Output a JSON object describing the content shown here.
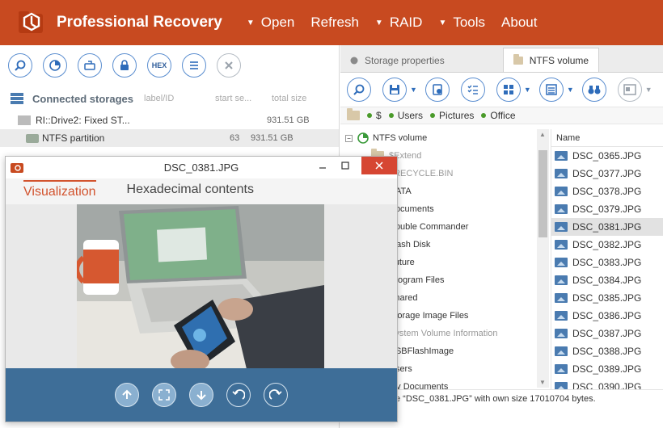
{
  "app": {
    "title": "Professional Recovery"
  },
  "menu": [
    {
      "label": "Open",
      "caret": true
    },
    {
      "label": "Refresh",
      "caret": false
    },
    {
      "label": "RAID",
      "caret": true
    },
    {
      "label": "Tools",
      "caret": true
    },
    {
      "label": "About",
      "caret": false
    }
  ],
  "left": {
    "hex_label": "HEX",
    "header": {
      "title": "Connected storages",
      "col_label": "label/ID",
      "col_start": "start se...",
      "col_total": "total size"
    },
    "storages": [
      {
        "name": "RI::Drive2: Fixed ST...",
        "start": "",
        "size": "931.51 GB"
      },
      {
        "name": "NTFS partition",
        "start": "63",
        "size": "931.51 GB"
      }
    ]
  },
  "right": {
    "tabs": {
      "storage": "Storage properties",
      "volume": "NTFS volume"
    },
    "breadcrumb": [
      "$",
      "Users",
      "Pictures",
      "Office"
    ],
    "tree_root": "NTFS volume",
    "tree": [
      "$Extend",
      "$RECYCLE.BIN",
      "DATA",
      "Documents",
      "Double Commander",
      "Flash Disk",
      "Future",
      "Program Files",
      "Shared",
      "Storage Image Files",
      "System Volume Information",
      "USBFlashImage",
      "Users",
      "My Documents"
    ],
    "files_header": "Name",
    "files": [
      "DSC_0365.JPG",
      "DSC_0377.JPG",
      "DSC_0378.JPG",
      "DSC_0379.JPG",
      "DSC_0381.JPG",
      "DSC_0382.JPG",
      "DSC_0383.JPG",
      "DSC_0384.JPG",
      "DSC_0385.JPG",
      "DSC_0386.JPG",
      "DSC_0387.JPG",
      "DSC_0388.JPG",
      "DSC_0389.JPG",
      "DSC_0390.JPG"
    ],
    "status": "e “DSC_0381.JPG” with own size 17010704 bytes."
  },
  "preview": {
    "title": "DSC_0381.JPG",
    "tabs": {
      "visual": "Visualization",
      "hex": "Hexadecimal contents"
    }
  },
  "colors": {
    "brand": "#c84a20",
    "accent": "#2e6cba",
    "preview_bar": "#3e6e98",
    "close": "#d64632"
  }
}
